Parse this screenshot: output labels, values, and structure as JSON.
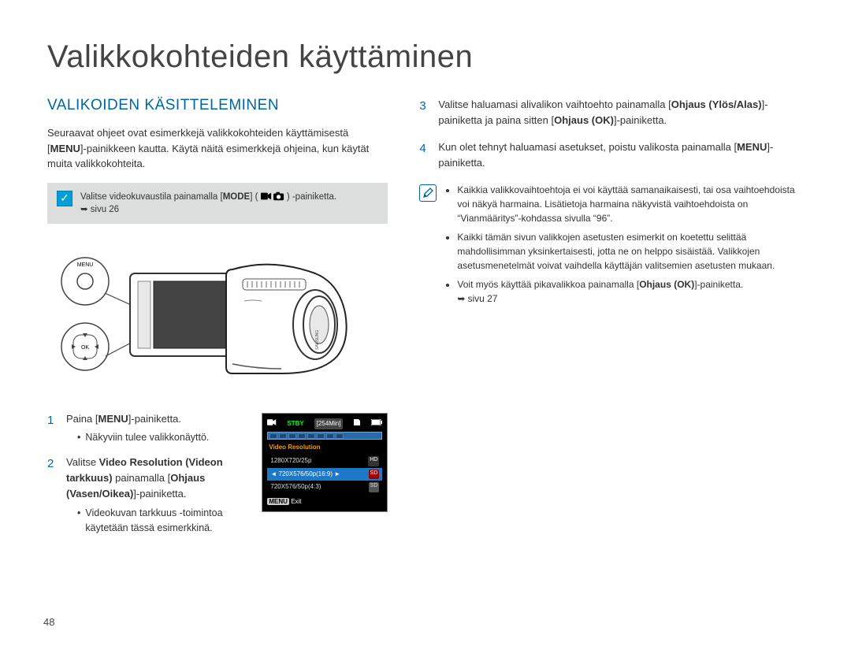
{
  "title": "Valikkokohteiden käyttäminen",
  "section_heading": "VALIKOIDEN KÄSITTELEMINEN",
  "intro": "Seuraavat ohjeet ovat esimerkkejä valikkokohteiden käyttämisestä [MENU]-painikkeen kautta. Käytä näitä esimerkkejä ohjeina, kun käytät muita valikkokohteita.",
  "mode_note": {
    "text_before": "Valitse videokuvaustila painamalla [",
    "mode_label": "MODE",
    "text_middle": "] ( ",
    "text_after": " ) -painiketta.",
    "page_ref": "sivu 26"
  },
  "camcorder": {
    "menu_button_label": "MENU",
    "ok_label": "OK"
  },
  "steps_left": [
    {
      "num": "1",
      "text_before": "Paina [",
      "bold": "MENU",
      "text_after": "]-painiketta.",
      "sub": "Näkyviin tulee valikkonäyttö."
    },
    {
      "num": "2",
      "text_before": "Valitse ",
      "bold": "Video Resolution (Videon tarkkuus)",
      "text_mid": " painamalla [",
      "bold2": "Ohjaus (Vasen/Oikea)",
      "text_after": "]-painiketta.",
      "sub": "Videokuvan tarkkuus -toimintoa käytetään tässä esimerkkinä."
    }
  ],
  "lcd": {
    "stby": "STBY",
    "time": "[254Min]",
    "menu_title": "Video Resolution",
    "items": [
      {
        "label": "1280X720/25p",
        "badge": "HD",
        "selected": false,
        "hd": true
      },
      {
        "label": "720X576/50p(16:9)",
        "badge": "SD",
        "selected": true,
        "hd": false
      },
      {
        "label": "720X576/50p(4:3)",
        "badge": "SD",
        "selected": false,
        "hd": false
      }
    ],
    "exit_chip": "MENU",
    "exit_label": "Exit"
  },
  "steps_right": [
    {
      "num": "3",
      "text_before": "Valitse haluamasi alivalikon vaihtoehto painamalla [",
      "bold": "Ohjaus (Ylös/Alas)",
      "text_mid": "]-painiketta ja paina sitten [",
      "bold2": "Ohjaus (OK)",
      "text_after": "]-painiketta."
    },
    {
      "num": "4",
      "text_before": "Kun olet tehnyt haluamasi asetukset, poistu valikosta painamalla [",
      "bold": "MENU",
      "text_after": "]-painiketta."
    }
  ],
  "right_notes": [
    "Kaikkia valikkovaihtoehtoja ei voi käyttää samanaikaisesti, tai osa vaihtoehdoista voi näkyä harmaina. Lisätietoja harmaina näkyvistä vaihtoehdoista on “Vianmääritys”-kohdassa sivulla “96”.",
    "Kaikki tämän sivun valikkojen asetusten esimerkit on koetettu selittää mahdollisimman yksinkertaisesti, jotta ne on helppo sisäistää. Valikkojen asetusmenetelmät voivat vaihdella käyttäjän valitsemien asetusten mukaan."
  ],
  "right_note_3_before": "Voit myös käyttää pikavalikkoa painamalla [",
  "right_note_3_bold": "Ohjaus (OK)",
  "right_note_3_after": "]-painiketta.",
  "right_note_3_ref": "sivu 27",
  "page_number": "48"
}
